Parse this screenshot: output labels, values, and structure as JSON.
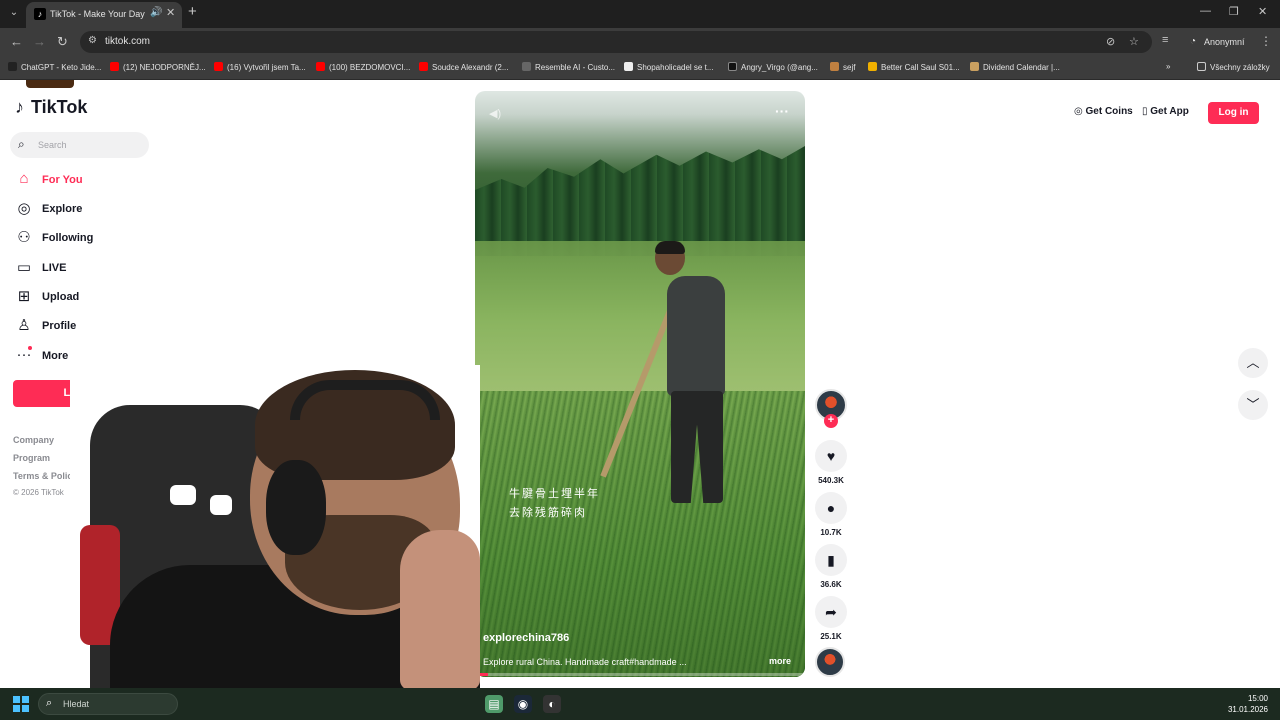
{
  "browser": {
    "tab_title": "TikTok - Make Your Day",
    "tab_favicon": "tiktok-icon",
    "url": "tiktok.com",
    "profile_label": "Anonymní",
    "bookmarks": [
      "ChatGPT - Keto Jide...",
      "(12) NEJODPORNĚJ...",
      "(16) Vytvořil jsem Ta...",
      "(100) BEZDOMOVCI...",
      "Soudce Alexandr (2...",
      "Resemble AI - Custo...",
      "Shopaholicadel se t...",
      "Angry_Virgo (@ang...",
      "sejf",
      "Better Call Saul S01...",
      "Dividend Calendar |..."
    ],
    "all_bookmarks_label": "Všechny záložky"
  },
  "tiktok": {
    "logo_text": "TikTok",
    "search_placeholder": "Search",
    "nav": [
      {
        "label": "For You",
        "icon": "home-icon",
        "active": true
      },
      {
        "label": "Explore",
        "icon": "compass-icon",
        "active": false
      },
      {
        "label": "Following",
        "icon": "user-plus-icon",
        "active": false
      },
      {
        "label": "LIVE",
        "icon": "tv-icon",
        "active": false
      },
      {
        "label": "Upload",
        "icon": "plus-square-icon",
        "active": false
      },
      {
        "label": "Profile",
        "icon": "person-icon",
        "active": false
      },
      {
        "label": "More",
        "icon": "dots-icon",
        "active": false
      }
    ],
    "sidebar_login": "Log in",
    "footer": [
      "Company",
      "Program",
      "Terms & Policies"
    ],
    "copyright": "© 2026 TikTok",
    "header": {
      "get_coins": "Get Coins",
      "get_app": "Get App",
      "login": "Log in"
    },
    "video": {
      "caption_line1": "牛腱骨土埋半年",
      "caption_line2": "去除残筋碎肉",
      "username": "explorechina786",
      "description": "Explore rural China. Handmade craft#handmade ...",
      "more_label": "more",
      "progress": 0.04
    },
    "actions": {
      "likes": "540.3K",
      "comments": "10.7K",
      "saves": "36.6K",
      "shares": "25.1K"
    },
    "accent_color": "#fe2c55"
  },
  "taskbar": {
    "search_placeholder": "Hledat",
    "time": "15:00",
    "date": "31.01.2026"
  }
}
